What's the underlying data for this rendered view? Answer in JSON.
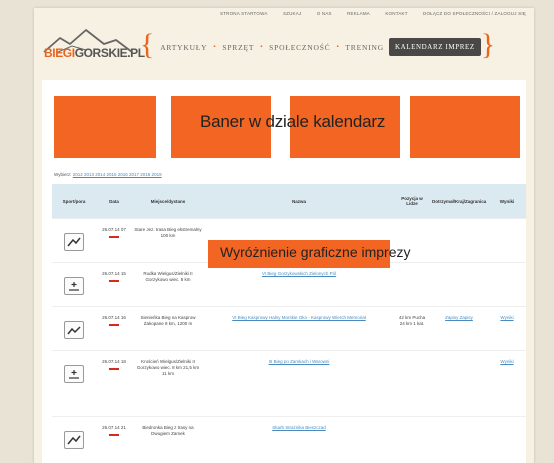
{
  "top_nav": [
    "Strona startowa",
    "Szukaj",
    "O nas",
    "Reklama",
    "Kontakt",
    "Dołącz do społeczności / Zaloguj się"
  ],
  "logo": {
    "prefix": "BIEGI",
    "suffix": "GORSKIE.PL"
  },
  "menu": {
    "items": [
      "Artykuły",
      "Sprzęt",
      "Społeczność",
      "Trening"
    ],
    "active": "Kalendarz imprez"
  },
  "banner": {
    "text": "Baner w dziale kalendarz"
  },
  "pager": {
    "prefix": "Wybierz:",
    "links": "2012 2013 2014 2015 2016 2017 2018 2019"
  },
  "table": {
    "headers": [
      "Sport/pora",
      "Data",
      "Miejsce/dystans",
      "Nazwa",
      "Pozycja w Lidze",
      "Dotrzymał/Kraj/Zagranica",
      "Wyniki"
    ],
    "rows": [
      {
        "icon": "mountain-run-icon",
        "date": "26.07.14 07",
        "place": "Stare Jez. trasa Bieg ekstremalny 100 km",
        "name": "",
        "pos": "",
        "reg": "",
        "res": ""
      },
      {
        "icon": "snow-run-icon",
        "date": "26.07.14 15",
        "place": "Rudka Wielgus/Zielniki II Gorzykowo wiec. 8 km",
        "name": "VI Bieg Gorzykowskich Zielonych Pól",
        "pos": "",
        "reg": "",
        "res": ""
      },
      {
        "icon": "mountain-run-icon",
        "date": "26.07.14 16",
        "place": "Sienieńka Bieg na Kasprow Zakopane 8 km, 1200 m",
        "name": "VI Bieg Kasprowy Halny Morskie Oko - Kasprowy Wierch Memoriał",
        "pos": "42 km Pucha 24 km 1 kat.",
        "reg": "Zapisy Zapisy",
        "res": "Wyniki"
      },
      {
        "icon": "snow-run-icon",
        "date": "26.07.14 18",
        "place": "Kroścień Wielgus/Zielniki II Gorzykowo wiec. 8 km 21,5 km 11 km",
        "name": "III Bieg po Zamkach i Warowni",
        "pos": "",
        "reg": "",
        "res": "Wyniki"
      },
      {
        "icon": "mountain-run-icon",
        "date": "26.07.14 21",
        "place": "Biedronka Bieg z trasy na Dwugiem Zamek",
        "name": "Skarb Strażnika Bieszczad",
        "pos": "",
        "reg": "",
        "res": ""
      }
    ]
  },
  "highlight": {
    "text": "Wyróżnienie graficzne imprezy"
  }
}
